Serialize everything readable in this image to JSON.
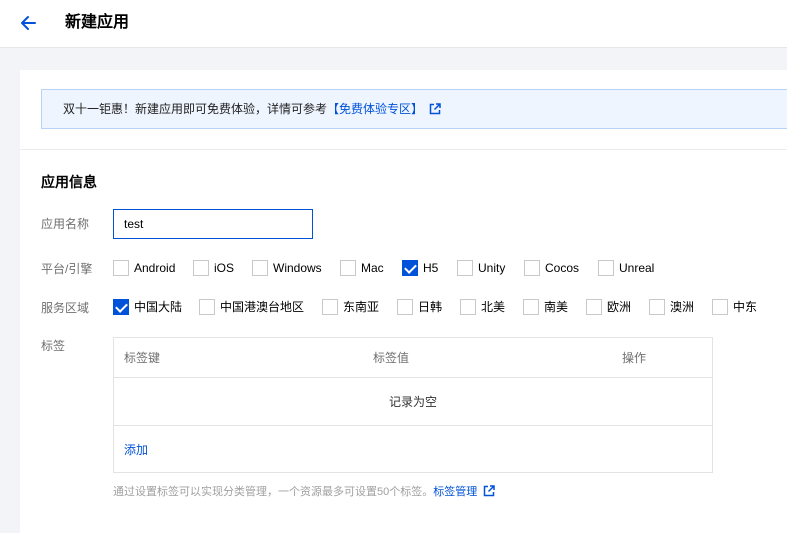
{
  "header": {
    "title": "新建应用",
    "back_icon": "arrow-left-icon"
  },
  "notice": {
    "text": "双十一钜惠！新建应用即可免费体验，详情可参考",
    "link": "【免费体验专区】",
    "link_icon": "external-link-icon"
  },
  "section": {
    "title": "应用信息"
  },
  "form": {
    "name_label": "应用名称",
    "name_value": "test",
    "platform_label": "平台/引擎",
    "platforms": [
      {
        "label": "Android",
        "checked": false
      },
      {
        "label": "iOS",
        "checked": false
      },
      {
        "label": "Windows",
        "checked": false
      },
      {
        "label": "Mac",
        "checked": false
      },
      {
        "label": "H5",
        "checked": true
      },
      {
        "label": "Unity",
        "checked": false
      },
      {
        "label": "Cocos",
        "checked": false
      },
      {
        "label": "Unreal",
        "checked": false
      }
    ],
    "region_label": "服务区域",
    "regions": [
      {
        "label": "中国大陆",
        "checked": true
      },
      {
        "label": "中国港澳台地区",
        "checked": false
      },
      {
        "label": "东南亚",
        "checked": false
      },
      {
        "label": "日韩",
        "checked": false
      },
      {
        "label": "北美",
        "checked": false
      },
      {
        "label": "南美",
        "checked": false
      },
      {
        "label": "欧洲",
        "checked": false
      },
      {
        "label": "澳洲",
        "checked": false
      },
      {
        "label": "中东",
        "checked": false
      }
    ],
    "tag_label": "标签"
  },
  "tags": {
    "columns": [
      "标签键",
      "标签值",
      "操作"
    ],
    "empty_text": "记录为空",
    "add_label": "添加"
  },
  "hint": {
    "text": "通过设置标签可以实现分类管理，一个资源最多可设置50个标签。",
    "link": "标签管理",
    "link_icon": "external-link-icon"
  },
  "colors": {
    "accent": "#0052d9",
    "notice_bg": "#eef5ff",
    "notice_border": "#b9d3f7"
  }
}
